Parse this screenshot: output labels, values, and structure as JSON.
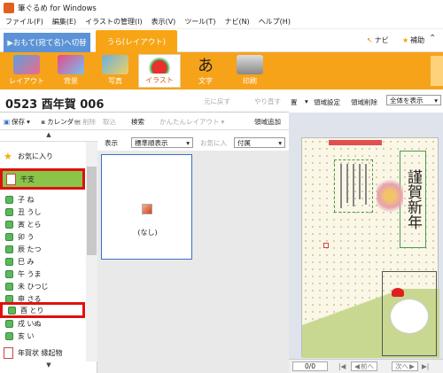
{
  "window": {
    "title": "筆ぐるめ for Windows"
  },
  "menu": [
    "ファイル(F)",
    "編集(E)",
    "イラストの管理(I)",
    "表示(V)",
    "ツール(T)",
    "ナビ(N)",
    "ヘルプ(H)"
  ],
  "tabs": {
    "switch_label": "▶おもて(宛て名)へ切替",
    "current_label": "うら(レイアウト)"
  },
  "header_links": {
    "navi": "ナビ",
    "hojo": "補助"
  },
  "ribbon": [
    {
      "label": "レイアウト",
      "active": false
    },
    {
      "label": "背景",
      "active": false
    },
    {
      "label": "写真",
      "active": false
    },
    {
      "label": "イラスト",
      "active": true
    },
    {
      "label": "文字",
      "active": false
    },
    {
      "label": "印刷",
      "active": false
    }
  ],
  "file": {
    "name": "0523 酉年賀 006",
    "undo": "元に戻す",
    "redo": "やり直す"
  },
  "toolbar": {
    "save": "保存",
    "calendar": "カレンダー",
    "delete": "削除",
    "take": "取込",
    "search": "検索",
    "layout": "かんたんレイアウト",
    "add_area": "領域追加"
  },
  "sidebar": {
    "scroll_up": "▲",
    "scroll_down": "▼",
    "favorites": "お気に入り",
    "eto": "干支",
    "items": [
      "子 ね",
      "丑 うし",
      "寅 とら",
      "卯 う",
      "辰 たつ",
      "巳 み",
      "午 うま",
      "未 ひつじ",
      "申 さる",
      "酉 とり",
      "戌 いぬ",
      "亥 い"
    ],
    "bottom_category": "年賀状 縁起物"
  },
  "mid": {
    "display_label": "表示",
    "display_select": "標準順表示",
    "fav_label": "お気に入",
    "fav_select": "付属",
    "none_label": "(なし)"
  },
  "right": {
    "tool1": "置",
    "area_settings": "領域設定",
    "area_delete": "領域削除",
    "view_select": "全体を表示",
    "greeting": "謹賀新年",
    "page_count": "0/0",
    "prev": "前へ",
    "next": "次へ"
  }
}
